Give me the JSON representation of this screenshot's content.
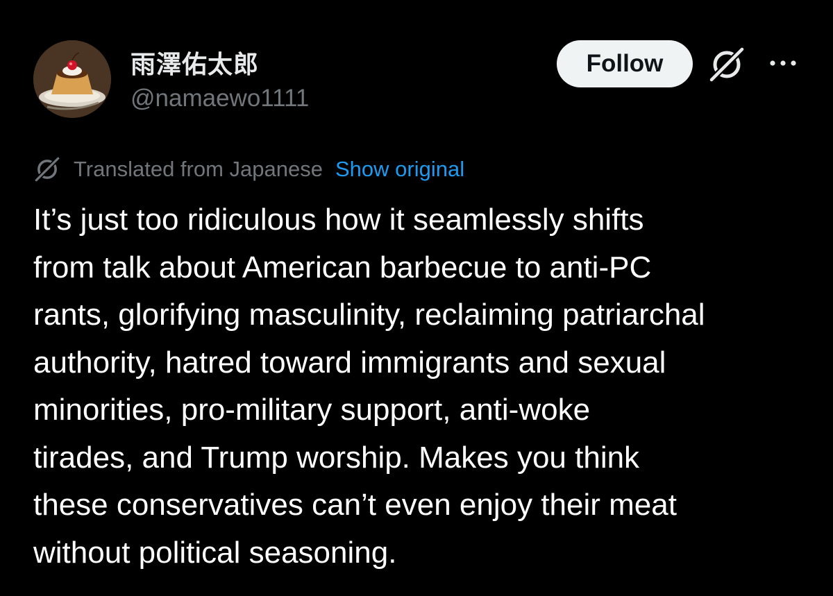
{
  "author": {
    "display_name": "雨澤佑太郎",
    "handle": "@namaewo1111",
    "avatar_icon": "pudding-avatar"
  },
  "actions": {
    "follow_label": "Follow",
    "grok_icon": "grok-icon",
    "more_icon": "more-horizontal-icon"
  },
  "translation": {
    "icon": "grok-icon",
    "label": "Translated from Japanese",
    "show_original_label": "Show original"
  },
  "post": {
    "text": "It’s just too ridiculous how it seamlessly shifts\nfrom talk about American barbecue to anti-PC\nrants, glorifying masculinity, reclaiming patriarchal\nauthority, hatred toward immigrants and sexual\nminorities, pro-military support, anti-woke\ntirades, and Trump worship. Makes you think\nthese conservatives can’t even enjoy their meat\nwithout political seasoning."
  },
  "colors": {
    "background": "#000000",
    "primary_text": "#e7e9ea",
    "secondary_text": "#71767b",
    "link": "#1d9bf0",
    "follow_bg": "#eff3f4"
  }
}
